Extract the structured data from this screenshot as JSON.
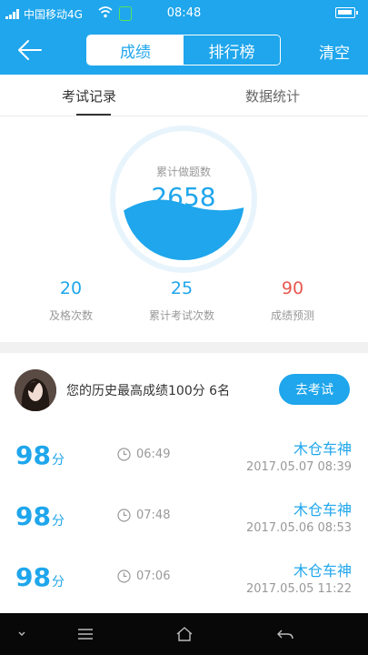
{
  "status_bar": {
    "carrier": "中国移动4G",
    "time": "08:48"
  },
  "header": {
    "tabs": [
      "成绩",
      "排行榜"
    ],
    "clear": "清空"
  },
  "tabs": [
    "考试记录",
    "数据统计"
  ],
  "circle": {
    "label": "累计做题数",
    "value": "2658"
  },
  "stats": [
    {
      "value": "20",
      "label": "及格次数"
    },
    {
      "value": "25",
      "label": "累计考试次数"
    },
    {
      "value": "90",
      "label": "成绩预测"
    }
  ],
  "best": {
    "text": "您的历史最高成绩100分  6名",
    "button": "去考试"
  },
  "records": [
    {
      "score": "98",
      "unit": "分",
      "duration": "06:49",
      "name": "木仓车神",
      "date": "2017.05.07  08:39"
    },
    {
      "score": "98",
      "unit": "分",
      "duration": "07:48",
      "name": "木仓车神",
      "date": "2017.05.06  08:53"
    },
    {
      "score": "98",
      "unit": "分",
      "duration": "07:06",
      "name": "木仓车神",
      "date": "2017.05.05  11:22"
    }
  ],
  "colors": {
    "primary": "#1fa6ec",
    "danger": "#e8584f"
  }
}
